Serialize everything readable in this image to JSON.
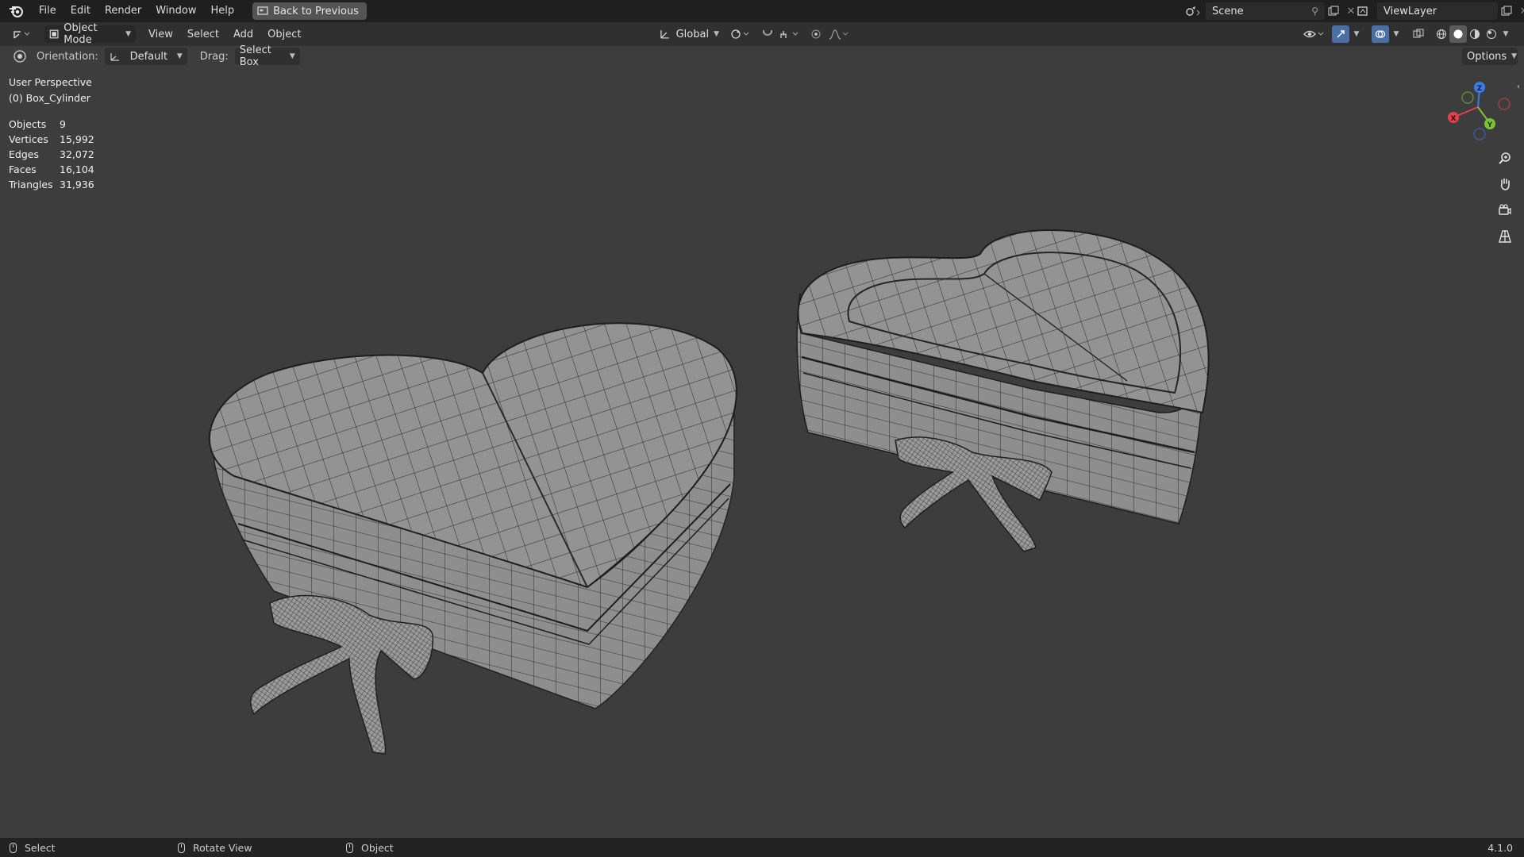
{
  "topbar": {
    "menu": [
      "File",
      "Edit",
      "Render",
      "Window",
      "Help"
    ],
    "back_button": "Back to Previous",
    "scene": "Scene",
    "view_layer": "ViewLayer"
  },
  "header": {
    "mode": "Object Mode",
    "menu": [
      "View",
      "Select",
      "Add",
      "Object"
    ],
    "transform_orientation": "Global"
  },
  "toolbar": {
    "orientation_label": "Orientation:",
    "orientation_value": "Default",
    "drag_label": "Drag:",
    "drag_value": "Select Box",
    "options": "Options"
  },
  "viewport": {
    "perspective": "User Perspective",
    "active_object": "(0) Box_Cylinder",
    "stats": [
      {
        "label": "Objects",
        "value": "9"
      },
      {
        "label": "Vertices",
        "value": "15,992"
      },
      {
        "label": "Edges",
        "value": "32,072"
      },
      {
        "label": "Faces",
        "value": "16,104"
      },
      {
        "label": "Triangles",
        "value": "31,936"
      }
    ],
    "gizmo_axes": {
      "x": "X",
      "y": "Y",
      "z": "Z"
    }
  },
  "statusbar": {
    "items": [
      "Select",
      "Rotate View",
      "Object"
    ],
    "version": "4.1.0"
  },
  "icons": {
    "logo": "blender-logo-icon",
    "zoom": "zoom-icon",
    "pan": "hand-pan-icon",
    "camera": "camera-icon",
    "grid": "ortho-grid-icon"
  },
  "colors": {
    "x_axis": "#e0424e",
    "y_axis": "#7ec23a",
    "z_axis": "#3a7ee6"
  }
}
